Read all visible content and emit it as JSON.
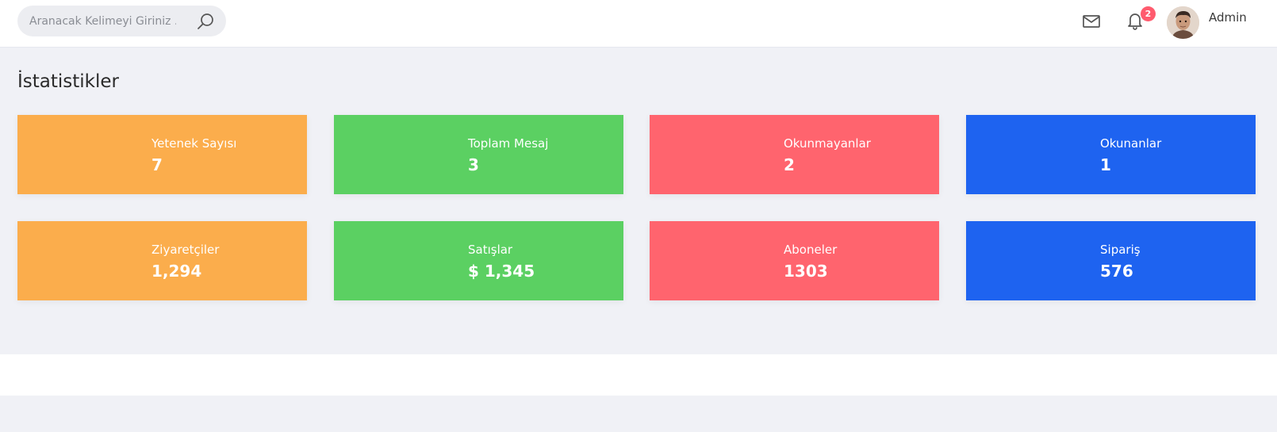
{
  "header": {
    "search_placeholder": "Aranacak Kelimeyi Giriniz ...",
    "notification_count": "2",
    "user_name": "Admin",
    "icons": {
      "search": "search-icon",
      "mail": "mail-icon",
      "bell": "bell-icon"
    }
  },
  "page": {
    "title": "İstatistikler"
  },
  "stats": [
    {
      "label": "Yetenek Sayısı",
      "value": "7",
      "color": "#fbad4c"
    },
    {
      "label": "Toplam Mesaj",
      "value": "3",
      "color": "#5bd062"
    },
    {
      "label": "Okunmayanlar",
      "value": "2",
      "color": "#ff646e"
    },
    {
      "label": "Okunanlar",
      "value": "1",
      "color": "#1e63f0"
    },
    {
      "label": "Ziyaretçiler",
      "value": "1,294",
      "color": "#fbad4c"
    },
    {
      "label": "Satışlar",
      "value": "$ 1,345",
      "color": "#5bd062"
    },
    {
      "label": "Aboneler",
      "value": "1303",
      "color": "#ff646e"
    },
    {
      "label": "Sipariş",
      "value": "576",
      "color": "#1e63f0"
    }
  ]
}
